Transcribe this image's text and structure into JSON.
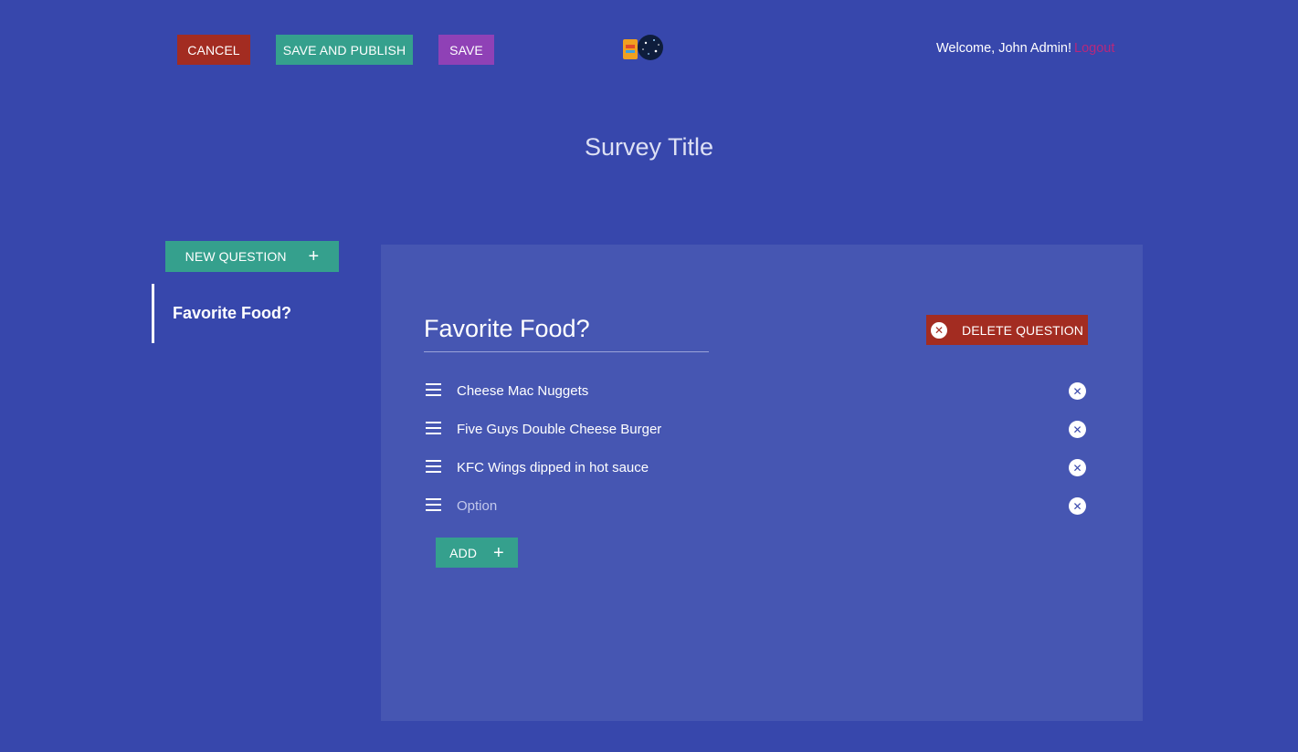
{
  "colors": {
    "background": "#3747ac",
    "panel": "#4656b2",
    "cancel": "#a32c21",
    "primary_teal": "#35a08d",
    "save_purple": "#8f41b6",
    "logout": "#b8287c"
  },
  "header": {
    "cancel_label": "CANCEL",
    "save_publish_label": "SAVE AND PUBLISH",
    "save_label": "SAVE",
    "welcome_text": "Welcome, John Admin!",
    "logout_label": "Logout"
  },
  "survey": {
    "title": "Survey Title"
  },
  "sidebar": {
    "new_question_label": "NEW QUESTION",
    "items": [
      {
        "label": "Favorite Food?"
      }
    ]
  },
  "question": {
    "title": "Favorite Food?",
    "delete_label": "DELETE QUESTION",
    "options": [
      {
        "text": "Cheese Mac Nuggets"
      },
      {
        "text": "Five Guys Double Cheese Burger"
      },
      {
        "text": "KFC Wings dipped in hot sauce"
      }
    ],
    "new_option_placeholder": "Option",
    "add_label": "ADD"
  },
  "icons": {
    "plus": "plus-icon",
    "remove": "close-circle-icon",
    "drag": "drag-handle-icon"
  }
}
